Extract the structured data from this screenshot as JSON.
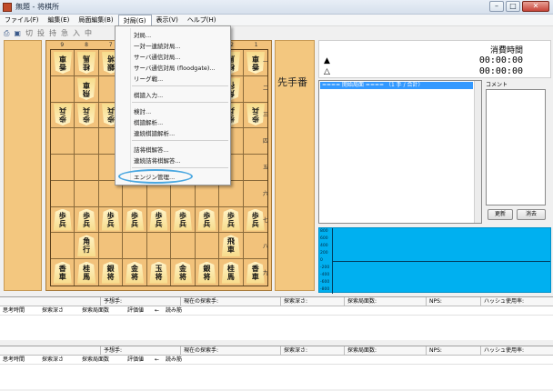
{
  "window": {
    "title": "無題 - 将棋所",
    "controls": [
      "–",
      "□",
      "✕"
    ]
  },
  "menubar": [
    {
      "label": "ファイル(F)",
      "active": false
    },
    {
      "label": "編集(E)",
      "active": false
    },
    {
      "label": "局面編集(B)",
      "active": false
    },
    {
      "label": "対局(G)",
      "active": true
    },
    {
      "label": "表示(V)",
      "active": false
    },
    {
      "label": "ヘルプ(H)",
      "active": false
    }
  ],
  "toolbar": [
    "切",
    "投",
    "持",
    "急",
    "入",
    "中"
  ],
  "dropdown": {
    "groups": [
      [
        "対局...",
        "一対一連続対局...",
        "サーバ通信対局...",
        "サーバ通信対局 (floodgate)...",
        "リーグ戦..."
      ],
      [
        "棋譜入力..."
      ],
      [
        "検討...",
        "棋譜解析...",
        "連続棋譜解析..."
      ],
      [
        "詰将棋解答...",
        "連続詰将棋解答..."
      ],
      [
        "エンジン管理..."
      ]
    ]
  },
  "board": {
    "files": [
      "9",
      "8",
      "7",
      "6",
      "5",
      "4",
      "3",
      "2",
      "1"
    ],
    "ranks": [
      "一",
      "二",
      "三",
      "四",
      "五",
      "六",
      "七",
      "八",
      "九"
    ],
    "pieces": [
      {
        "r": 0,
        "c": 0,
        "text": "香車",
        "gote": true
      },
      {
        "r": 0,
        "c": 1,
        "text": "桂馬",
        "gote": true
      },
      {
        "r": 0,
        "c": 2,
        "text": "銀将",
        "gote": true
      },
      {
        "r": 0,
        "c": 3,
        "text": "金将",
        "gote": true
      },
      {
        "r": 0,
        "c": 4,
        "text": "玉将",
        "gote": true
      },
      {
        "r": 0,
        "c": 5,
        "text": "金将",
        "gote": true
      },
      {
        "r": 0,
        "c": 6,
        "text": "銀将",
        "gote": true
      },
      {
        "r": 0,
        "c": 7,
        "text": "桂馬",
        "gote": true
      },
      {
        "r": 0,
        "c": 8,
        "text": "香車",
        "gote": true
      },
      {
        "r": 1,
        "c": 1,
        "text": "飛車",
        "gote": true
      },
      {
        "r": 1,
        "c": 7,
        "text": "角行",
        "gote": true
      },
      {
        "r": 2,
        "c": 0,
        "text": "歩兵",
        "gote": true
      },
      {
        "r": 2,
        "c": 1,
        "text": "歩兵",
        "gote": true
      },
      {
        "r": 2,
        "c": 2,
        "text": "歩兵",
        "gote": true
      },
      {
        "r": 2,
        "c": 3,
        "text": "歩兵",
        "gote": true
      },
      {
        "r": 2,
        "c": 4,
        "text": "歩兵",
        "gote": true
      },
      {
        "r": 2,
        "c": 5,
        "text": "歩兵",
        "gote": true
      },
      {
        "r": 2,
        "c": 6,
        "text": "歩兵",
        "gote": true
      },
      {
        "r": 2,
        "c": 7,
        "text": "歩兵",
        "gote": true
      },
      {
        "r": 2,
        "c": 8,
        "text": "歩兵",
        "gote": true
      },
      {
        "r": 6,
        "c": 0,
        "text": "歩兵",
        "gote": false
      },
      {
        "r": 6,
        "c": 1,
        "text": "歩兵",
        "gote": false
      },
      {
        "r": 6,
        "c": 2,
        "text": "歩兵",
        "gote": false
      },
      {
        "r": 6,
        "c": 3,
        "text": "歩兵",
        "gote": false
      },
      {
        "r": 6,
        "c": 4,
        "text": "歩兵",
        "gote": false
      },
      {
        "r": 6,
        "c": 5,
        "text": "歩兵",
        "gote": false
      },
      {
        "r": 6,
        "c": 6,
        "text": "歩兵",
        "gote": false
      },
      {
        "r": 6,
        "c": 7,
        "text": "歩兵",
        "gote": false
      },
      {
        "r": 6,
        "c": 8,
        "text": "歩兵",
        "gote": false
      },
      {
        "r": 7,
        "c": 1,
        "text": "角行",
        "gote": false
      },
      {
        "r": 7,
        "c": 7,
        "text": "飛車",
        "gote": false
      },
      {
        "r": 8,
        "c": 0,
        "text": "香車",
        "gote": false
      },
      {
        "r": 8,
        "c": 1,
        "text": "桂馬",
        "gote": false
      },
      {
        "r": 8,
        "c": 2,
        "text": "銀将",
        "gote": false
      },
      {
        "r": 8,
        "c": 3,
        "text": "金将",
        "gote": false
      },
      {
        "r": 8,
        "c": 4,
        "text": "玉将",
        "gote": false
      },
      {
        "r": 8,
        "c": 5,
        "text": "金将",
        "gote": false
      },
      {
        "r": 8,
        "c": 6,
        "text": "銀将",
        "gote": false
      },
      {
        "r": 8,
        "c": 7,
        "text": "桂馬",
        "gote": false
      },
      {
        "r": 8,
        "c": 8,
        "text": "香車",
        "gote": false
      }
    ]
  },
  "turn_label": "先手番",
  "time": {
    "header": "消費時間",
    "sente_mark": "▲",
    "gote_mark": "△",
    "sente_time": "00:00:00",
    "gote_time": "00:00:00"
  },
  "kifu": {
    "first_row": "==== 開始局面 ====  （1 手 / 合計）"
  },
  "comment": {
    "label": "コメント",
    "update_button": "更新",
    "clear_button": "消去"
  },
  "graph": {
    "ticks": [
      "800",
      "600",
      "400",
      "200",
      "0",
      "-200",
      "-400",
      "-600",
      "-800"
    ],
    "color": "#00b0f0"
  },
  "engine_panels": [
    {
      "headers": [
        "予想手:",
        "現在の探索手:",
        "探索深さ:",
        "探索局面数:",
        "NPS:",
        "ハッシュ使用率:"
      ],
      "subheaders": [
        "思考時間",
        "探索深さ",
        "探索局面数",
        "評価値",
        "←",
        "読み筋"
      ]
    },
    {
      "headers": [
        "予想手:",
        "現在の探索手:",
        "探索深さ:",
        "探索局面数:",
        "NPS:",
        "ハッシュ使用率:"
      ],
      "subheaders": [
        "思考時間",
        "探索深さ",
        "探索局面数",
        "評価値",
        "←",
        "読み筋"
      ]
    }
  ]
}
